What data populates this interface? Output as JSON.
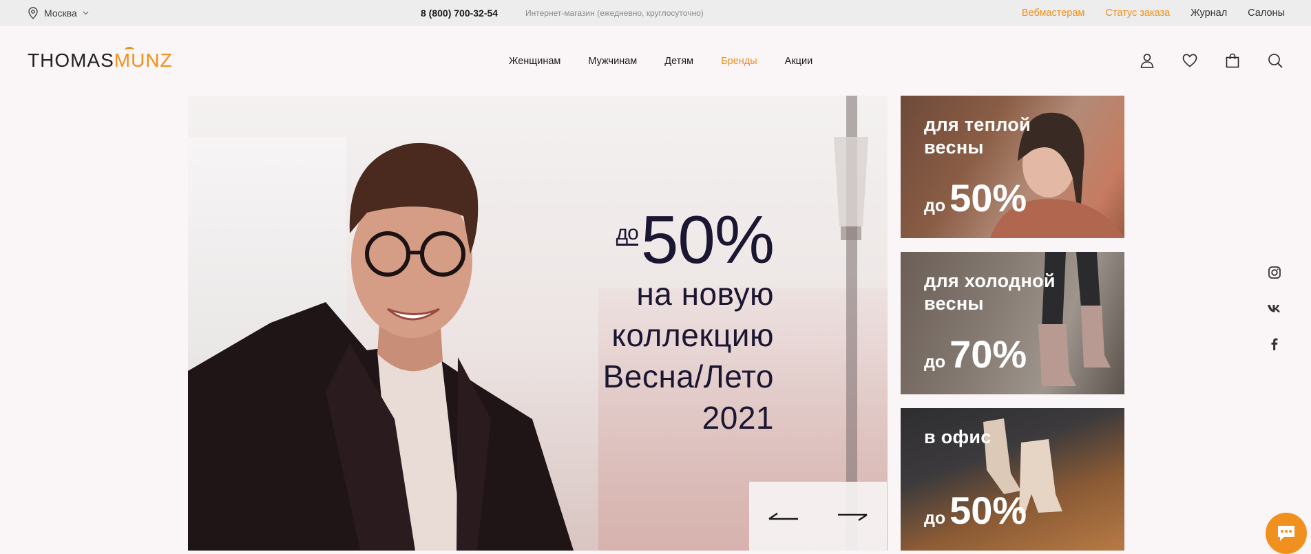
{
  "topbar": {
    "city": "Москва",
    "phone": "8 (800) 700-32-54",
    "phone_note": "Интернет-магазин (ежедневно, круглосуточно)",
    "links": [
      "Вебмастерам",
      "Статус заказа",
      "Журнал",
      "Салоны"
    ]
  },
  "header": {
    "logo_part1": "THOMAS",
    "logo_part2": "MUNZ",
    "nav": [
      "Женщинам",
      "Мужчинам",
      "Детям",
      "Бренды",
      "Акции"
    ],
    "active_nav": "Бренды",
    "icons": [
      "user-icon",
      "heart-icon",
      "bag-icon",
      "search-icon"
    ]
  },
  "hero": {
    "prefix": "до",
    "percent": "50%",
    "lines": [
      "на новую",
      "коллекцию",
      "Весна/Лето",
      "2021"
    ]
  },
  "promos": [
    {
      "title_line1": "для теплой",
      "title_line2": "весны",
      "prefix": "до",
      "value": "50%"
    },
    {
      "title_line1": "для холодной",
      "title_line2": "весны",
      "prefix": "до",
      "value": "70%"
    },
    {
      "title_line1": "в офис",
      "title_line2": "",
      "prefix": "до",
      "value": "50%"
    }
  ],
  "social": [
    "instagram-icon",
    "vk-icon",
    "facebook-icon"
  ],
  "colors": {
    "accent": "#f0901e",
    "topbar_bg": "#ededed",
    "page_bg": "#faf5f7",
    "hero_text": "#1b1631"
  }
}
